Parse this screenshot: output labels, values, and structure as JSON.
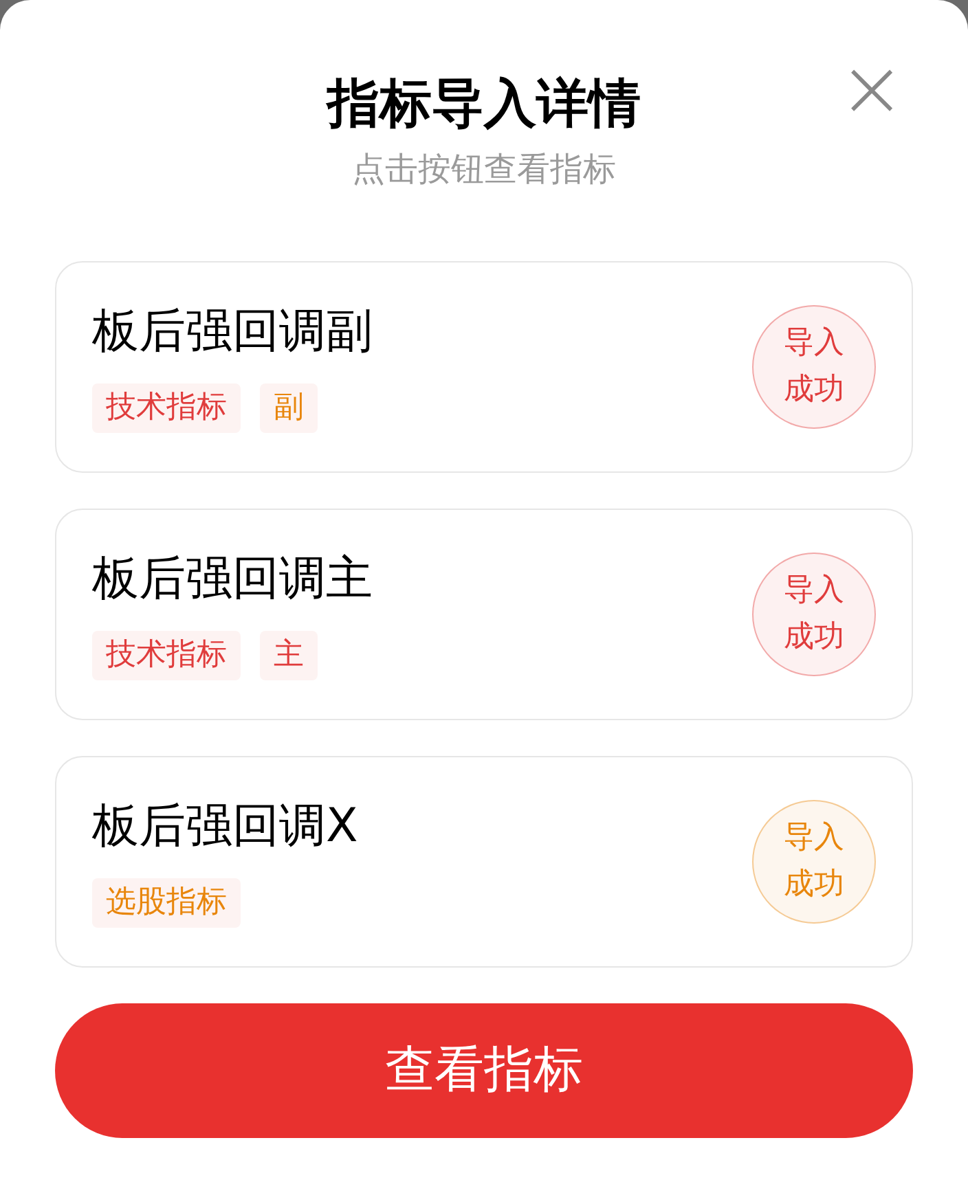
{
  "dialog": {
    "title": "指标导入详情",
    "subtitle": "点击按钮查看指标",
    "close": "×"
  },
  "items": [
    {
      "name": "板后强回调副",
      "tags": [
        {
          "label": "技术指标",
          "color": "#e03c3c"
        },
        {
          "label": "副",
          "color": "#e8860c"
        }
      ],
      "stamp": "导入成功",
      "color": "#e03c3c"
    },
    {
      "name": "板后强回调主",
      "tags": [
        {
          "label": "技术指标",
          "color": "#e03c3c"
        },
        {
          "label": "主",
          "color": "#e03c3c"
        }
      ],
      "stamp": "导入成功",
      "color": "#e03c3c"
    },
    {
      "name": "板后强回调X",
      "tags": [
        {
          "label": "选股指标",
          "color": "#e8860c"
        }
      ],
      "stamp": "导入成功",
      "color": "#e8860c"
    }
  ],
  "button": "查看指标"
}
